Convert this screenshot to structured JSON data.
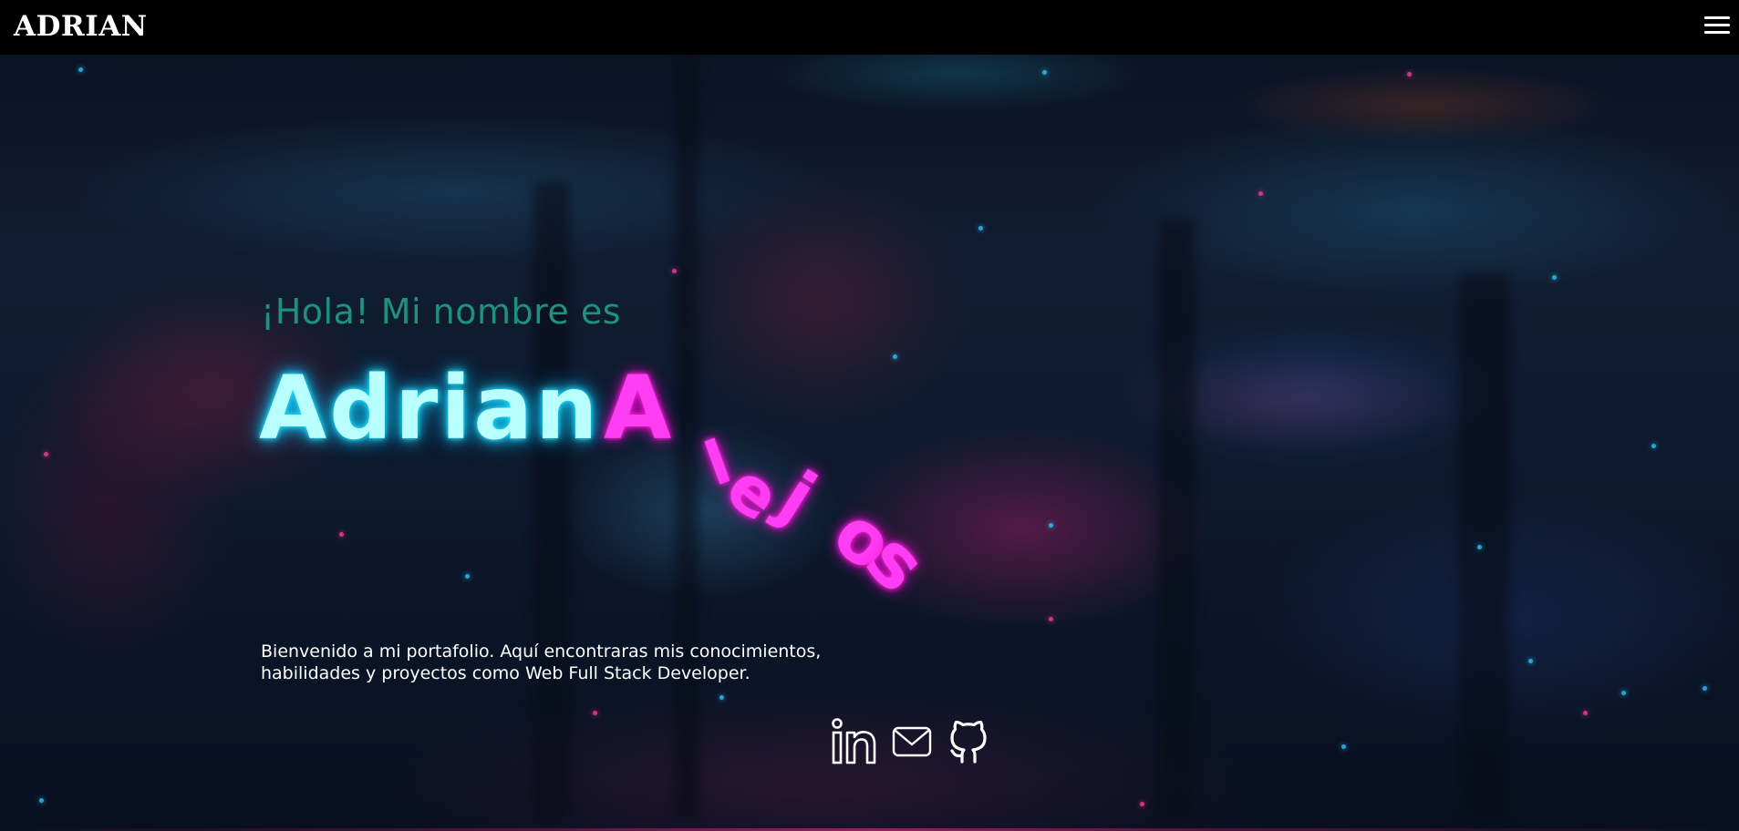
{
  "navbar": {
    "brand": "ADRIAN",
    "menu_icon": "hamburger-menu-icon"
  },
  "hero": {
    "greeting": "¡Hola! Mi nombre es",
    "first_name": "Adrian",
    "last_name": "Alejos",
    "description": "Bienvenido a mi portafolio. Aquí encontraras mis conocimientos, habilidades y proyectos como Web Full Stack Developer."
  },
  "social": [
    {
      "icon": "linkedin-icon"
    },
    {
      "icon": "mail-icon"
    },
    {
      "icon": "github-icon"
    }
  ],
  "colors": {
    "navbar_bg": "#000000",
    "greeting": "#1f8f7f",
    "first_name_neon": "#29e4ff",
    "last_name_neon": "#ff29e8",
    "text": "#ffffff"
  }
}
